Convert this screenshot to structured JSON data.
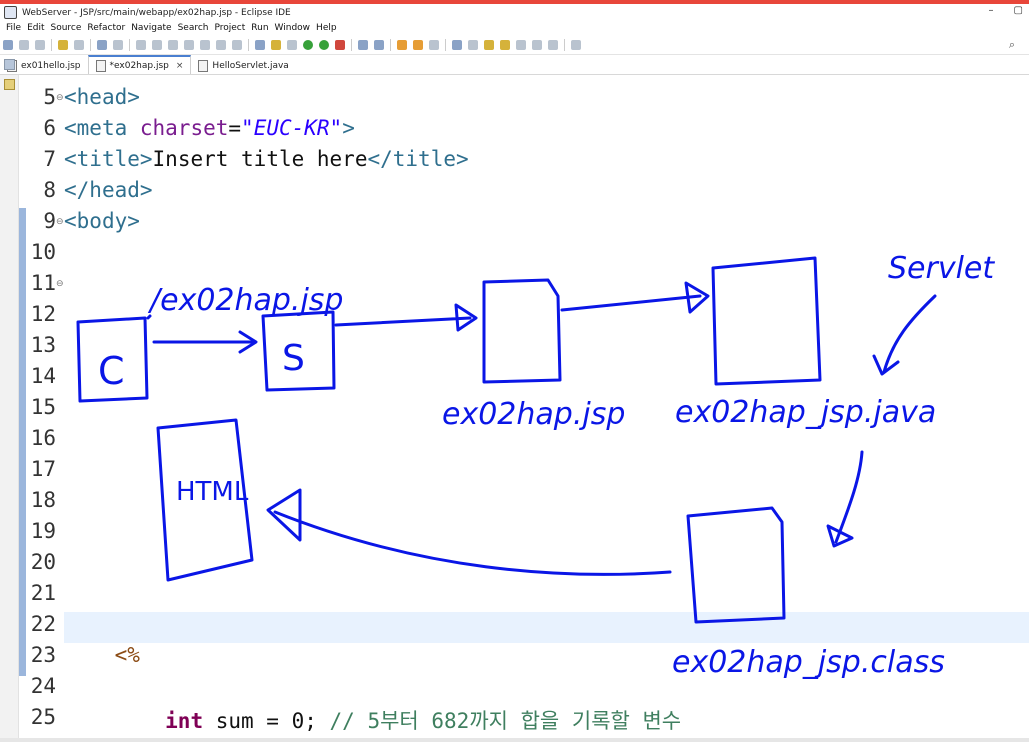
{
  "window": {
    "title": "WebServer - JSP/src/main/webapp/ex02hap.jsp - Eclipse IDE",
    "minimize": "–",
    "restore": "▢"
  },
  "menu": [
    "File",
    "Edit",
    "Source",
    "Refactor",
    "Navigate",
    "Search",
    "Project",
    "Run",
    "Window",
    "Help"
  ],
  "editor_tabs": [
    {
      "label": "ex01hello.jsp",
      "active": false
    },
    {
      "label": "*ex02hap.jsp",
      "active": true,
      "close": "×"
    },
    {
      "label": "HelloServlet.java",
      "active": false
    }
  ],
  "code": {
    "line_numbers": [
      "5",
      "6",
      "7",
      "8",
      "9",
      "10",
      "11",
      "12",
      "13",
      "14",
      "15",
      "16",
      "17",
      "18",
      "19",
      "20",
      "21",
      "22",
      "23",
      "24",
      "25"
    ],
    "lines": {
      "l5": {
        "open": "<",
        "tag": "head",
        "close": ">"
      },
      "l6": {
        "open": "<",
        "tag": "meta",
        "attr": " charset",
        "eq": "=",
        "val": "\"EUC-KR\"",
        "close": ">"
      },
      "l7": {
        "open": "<",
        "tag": "title",
        "close": ">",
        "text": "Insert title here",
        "open2": "</",
        "tag2": "title",
        "close2": ">"
      },
      "l8": {
        "open": "</",
        "tag": "head",
        "close": ">"
      },
      "l9": {
        "open": "<",
        "tag": "body",
        "close": ">"
      },
      "l23": {
        "jsp": "<%"
      },
      "l25": {
        "kw": "int",
        "text": " sum = 0; ",
        "comment": "// 5부터 682까지 합을 기록할 변수"
      }
    }
  },
  "annotation": {
    "label_request": "/ex02hap.jsp",
    "label_client": "C",
    "label_server": "S",
    "label_jsp": "ex02hap.jsp",
    "label_java": "ex02hap_jsp.java",
    "label_servlet": "Servlet",
    "label_class": "ex02hap_jsp.class",
    "label_html": "HTML",
    "ink_color": "#0a16e6"
  }
}
